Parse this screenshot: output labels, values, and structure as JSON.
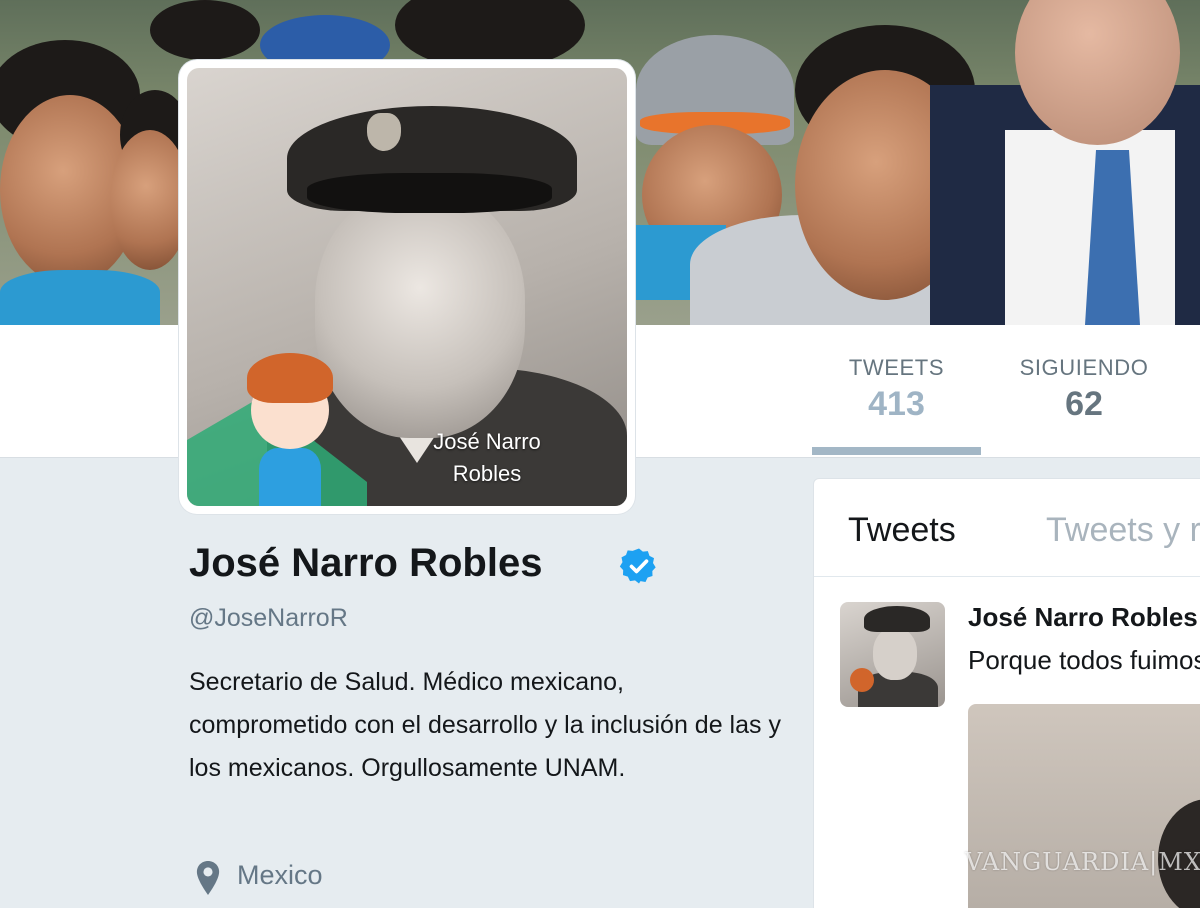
{
  "banner": {
    "alt": "header photo"
  },
  "avatar": {
    "caption_line1": "José Narro",
    "caption_line2": "Robles"
  },
  "stats": [
    {
      "label": "TWEETS",
      "value": "413"
    },
    {
      "label": "SIGUIENDO",
      "value": "62"
    }
  ],
  "profile": {
    "name": "José Narro Robles",
    "handle": "@JoseNarroR",
    "bio": "Secretario de Salud. Médico mexicano, comprometido con el desarrollo y la inclusión de las y los mexicanos. Orgullosamente UNAM.",
    "location": "Mexico",
    "verified": true
  },
  "timeline": {
    "tabs": [
      "Tweets",
      "Tweets y respuestas"
    ],
    "tweet": {
      "author": "José Narro Robles",
      "text": "Porque todos fuimos niños"
    }
  },
  "watermark": "VANGUARDIA|MX",
  "colors": {
    "verified": "#1da1f2",
    "accent": "#a3b7c6",
    "background": "#e6ecf0"
  }
}
